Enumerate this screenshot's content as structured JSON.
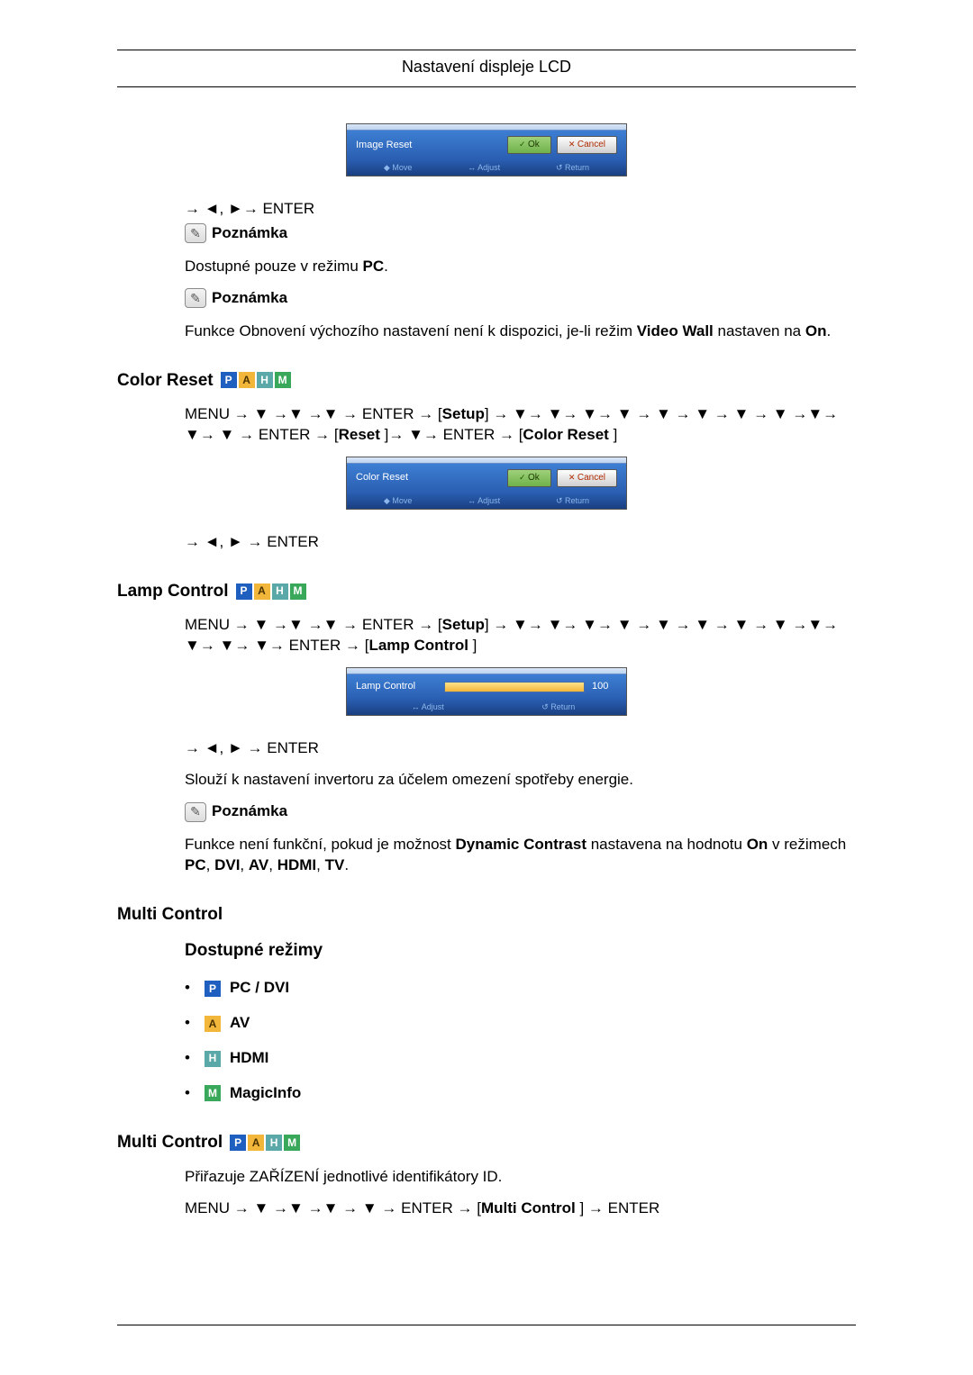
{
  "header": {
    "title": "Nastavení displeje LCD"
  },
  "osd_image_reset": {
    "label": "Image Reset",
    "ok": "Ok",
    "cancel": "Cancel",
    "foot_move": "◆ Move",
    "foot_adjust": "↔ Adjust",
    "foot_return": "↺ Return"
  },
  "arrow_enter_1": "→ ◄, ►→ ENTER",
  "note_label": "Poznámka",
  "pc_only_text_a": "Dostupné pouze v režimu ",
  "pc_only_text_b": "PC",
  "pc_only_text_c": ".",
  "note2_text_a": "Funkce Obnovení výchozího nastavení není k dispozici, je-li režim ",
  "note2_text_b": "Video Wall",
  "note2_text_c": " nastaven na ",
  "note2_text_d": "On",
  "note2_text_e": ".",
  "section_color_reset": "Color Reset",
  "color_reset_path_a": "MENU → ▼ →▼ →▼ → ENTER → [",
  "color_reset_path_b": "Setup",
  "color_reset_path_c": "] → ▼→ ▼→ ▼→ ▼ → ▼ → ▼ → ▼ → ▼ →▼→ ▼→ ▼ → ENTER → [",
  "color_reset_path_d": "Reset ",
  "color_reset_path_e": "]→ ▼→ ENTER → [",
  "color_reset_path_f": "Color Reset ",
  "color_reset_path_g": "]",
  "osd_color_reset": {
    "label": "Color Reset",
    "ok": "Ok",
    "cancel": "Cancel",
    "foot_move": "◆ Move",
    "foot_adjust": "↔ Adjust",
    "foot_return": "↺ Return"
  },
  "arrow_enter_2": "→ ◄, ► → ENTER",
  "section_lamp_control": "Lamp Control",
  "lamp_path_a": "MENU → ▼ →▼ →▼ → ENTER → [",
  "lamp_path_b": "Setup",
  "lamp_path_c": "] → ▼→ ▼→ ▼→ ▼ → ▼ → ▼ → ▼ → ▼ →▼→ ▼→ ▼→ ▼→ ENTER → [",
  "lamp_path_d": "Lamp Control ",
  "lamp_path_e": "]",
  "osd_lamp": {
    "label": "Lamp Control",
    "value": "100",
    "foot_adjust": "↔ Adjust",
    "foot_return": "↺ Return"
  },
  "arrow_enter_3": "→ ◄, ► → ENTER",
  "lamp_desc": "Slouží k nastavení invertoru za účelem omezení spotřeby energie.",
  "lamp_note_a": "Funkce není funkční, pokud je možnost ",
  "lamp_note_b": "Dynamic Contrast",
  "lamp_note_c": " nastavena na hodnotu ",
  "lamp_note_d": "On",
  "lamp_note_e": " v režimech ",
  "lamp_note_f": "PC",
  "lamp_note_g": ", ",
  "lamp_note_h": "DVI",
  "lamp_note_i": ", ",
  "lamp_note_j": "AV",
  "lamp_note_k": ", ",
  "lamp_note_l": "HDMI",
  "lamp_note_m": ", ",
  "lamp_note_n": "TV",
  "lamp_note_o": ".",
  "section_multi_control": "Multi Control",
  "subhead_modes": "Dostupné režimy",
  "modes": {
    "pc": "PC / DVI",
    "av": "AV",
    "hdmi": "HDMI",
    "magic": "MagicInfo"
  },
  "section_multi_control2": "Multi Control",
  "multi_desc": "Přiřazuje ZAŘÍZENÍ jednotlivé identifikátory ID.",
  "multi_path_a": "MENU → ▼ →▼ →▼ → ▼ → ENTER → [",
  "multi_path_b": "Multi Control ",
  "multi_path_c": "] → ENTER",
  "pahm": {
    "p": "P",
    "a": "A",
    "h": "H",
    "m": "M"
  }
}
